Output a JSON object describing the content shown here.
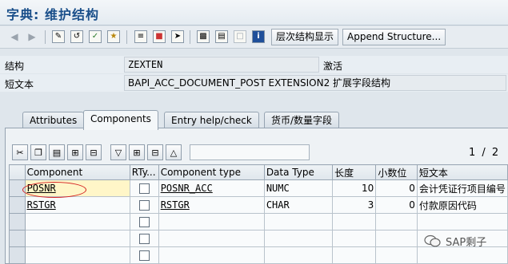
{
  "window": {
    "title": "字典: 维护结构"
  },
  "toolbar": {
    "hierarchy_button": "层次结构显示",
    "append_button": "Append Structure..."
  },
  "header": {
    "structure_label": "结构",
    "structure_value": "ZEXTEN",
    "status_value": "激活",
    "shorttext_label": "短文本",
    "shorttext_value": "BAPI_ACC_DOCUMENT_POST EXTENSION2 扩展字段结构"
  },
  "tabs": [
    {
      "label": "Attributes"
    },
    {
      "label": "Components"
    },
    {
      "label": "Entry help/check"
    },
    {
      "label": "货币/数量字段"
    }
  ],
  "pager": "1 / 2",
  "grid": {
    "columns": [
      "Component",
      "RTy...",
      "Component type",
      "Data Type",
      "长度",
      "小数位",
      "短文本"
    ],
    "rows": [
      {
        "component": "POSNR",
        "comptype": "POSNR_ACC",
        "datatype": "NUMC",
        "length": "10",
        "decimals": "0",
        "shorttext": "会计凭证行项目编号"
      },
      {
        "component": "RSTGR",
        "comptype": "RSTGR",
        "datatype": "CHAR",
        "length": "3",
        "decimals": "0",
        "shorttext": "付款原因代码"
      }
    ]
  },
  "watermark": "SAP剩子",
  "icons": [
    "back-icon",
    "forward-icon",
    "display-change-icon",
    "check-icon",
    "activate-icon",
    "where-used-icon",
    "object-list-icon",
    "navigation-icon",
    "hierarchy-icon",
    "info-icon"
  ],
  "colors": {
    "accent": "#1a4f8a",
    "highlight": "#d42020",
    "selected_cell": "#fff6c8"
  }
}
